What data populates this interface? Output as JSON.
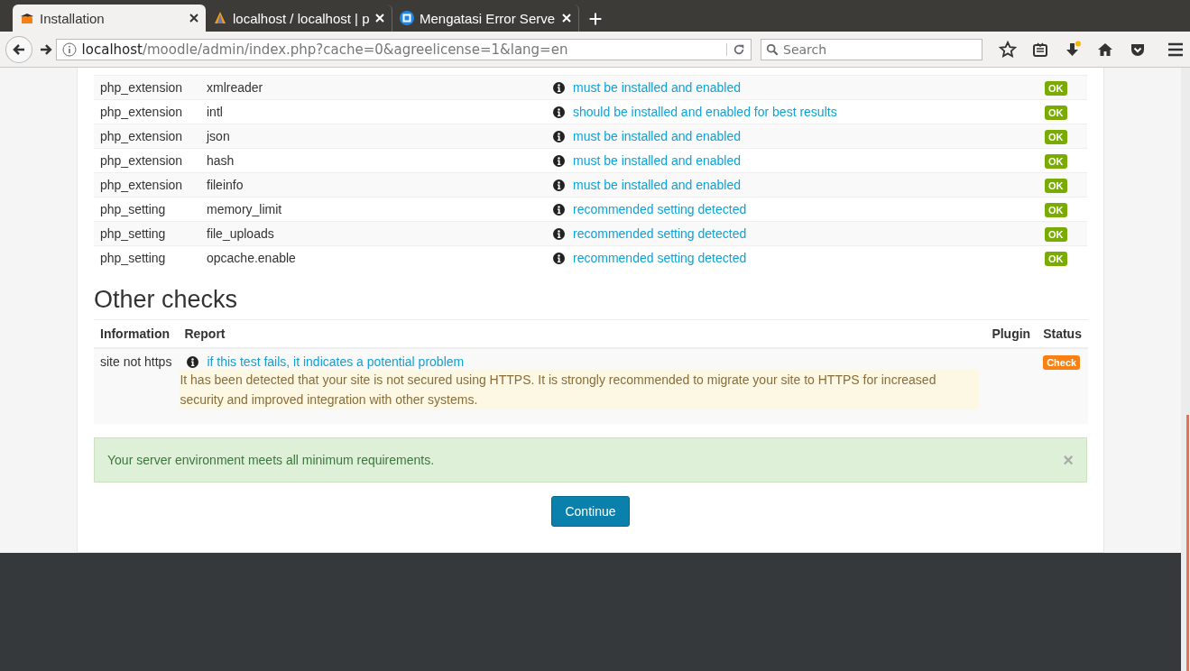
{
  "tabs": [
    {
      "label": "Installation",
      "selected": true
    },
    {
      "label": "localhost / localhost | p",
      "selected": false
    },
    {
      "label": "Mengatasi Error Serve",
      "selected": false
    }
  ],
  "address": {
    "host": "localhost",
    "path": "/moodle/admin/index.php?cache=0&agreelicense=1&lang=en"
  },
  "search": {
    "placeholder": "Search"
  },
  "requirements": [
    {
      "type": "php_extension",
      "name": "xmlreader",
      "report": "must be installed and enabled",
      "status": "OK"
    },
    {
      "type": "php_extension",
      "name": "intl",
      "report": "should be installed and enabled for best results",
      "status": "OK"
    },
    {
      "type": "php_extension",
      "name": "json",
      "report": "must be installed and enabled",
      "status": "OK"
    },
    {
      "type": "php_extension",
      "name": "hash",
      "report": "must be installed and enabled",
      "status": "OK"
    },
    {
      "type": "php_extension",
      "name": "fileinfo",
      "report": "must be installed and enabled",
      "status": "OK"
    },
    {
      "type": "php_setting",
      "name": "memory_limit",
      "report": "recommended setting detected",
      "status": "OK"
    },
    {
      "type": "php_setting",
      "name": "file_uploads",
      "report": "recommended setting detected",
      "status": "OK"
    },
    {
      "type": "php_setting",
      "name": "opcache.enable",
      "report": "recommended setting detected",
      "status": "OK"
    }
  ],
  "other_checks": {
    "title": "Other checks",
    "columns": [
      "Information",
      "Report",
      "Plugin",
      "Status"
    ],
    "rows": [
      {
        "information": "site not https",
        "report": "if this test fails, it indicates a potential problem",
        "detail": "It has been detected that your site is not secured using HTTPS. It is strongly recommended to migrate your site to HTTPS for increased security and improved integration with other systems.",
        "status": "Check"
      }
    ]
  },
  "alert": {
    "message": "Your server environment meets all minimum requirements.",
    "close": "×"
  },
  "continue_button": "Continue"
}
